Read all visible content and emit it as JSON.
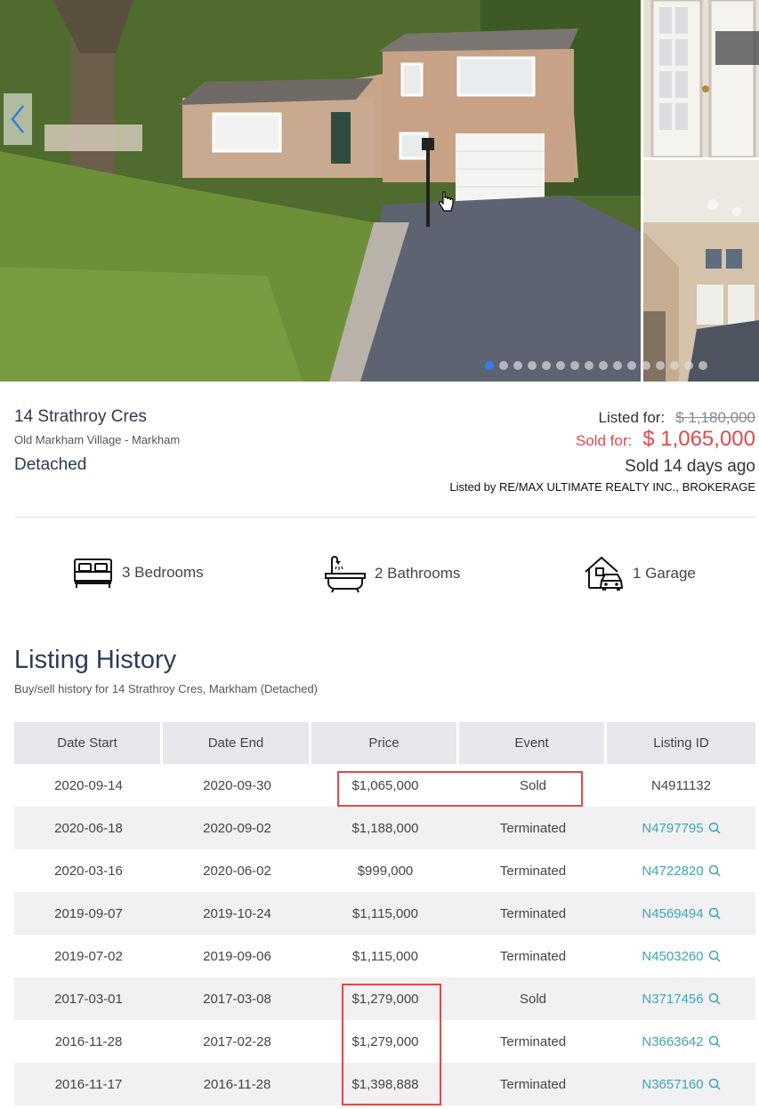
{
  "gallery": {
    "slide_count": 16,
    "active_slide": 1
  },
  "summary": {
    "address": "14 Strathroy Cres",
    "neighbourhood": "Old Markham Village - Markham",
    "property_type": "Detached",
    "listed_label": "Listed for:",
    "listed_price": "$ 1,180,000",
    "sold_label": "Sold for:",
    "sold_price": "$ 1,065,000",
    "sold_ago": "Sold 14 days ago",
    "listed_by": "Listed by RE/MAX ULTIMATE REALTY INC., BROKERAGE"
  },
  "features": {
    "bedrooms": "3 Bedrooms",
    "bathrooms": "2 Bathrooms",
    "garage": "1 Garage"
  },
  "history": {
    "title": "Listing History",
    "subtitle": "Buy/sell history for 14 Strathroy Cres, Markham (Detached)",
    "columns": [
      "Date Start",
      "Date End",
      "Price",
      "Event",
      "Listing ID"
    ],
    "rows": [
      {
        "start": "2020-09-14",
        "end": "2020-09-30",
        "price": "$1,065,000",
        "event": "Sold",
        "id": "N4911132"
      },
      {
        "start": "2020-06-18",
        "end": "2020-09-02",
        "price": "$1,188,000",
        "event": "Terminated",
        "id": "N4797795"
      },
      {
        "start": "2020-03-16",
        "end": "2020-06-02",
        "price": "$999,000",
        "event": "Terminated",
        "id": "N4722820"
      },
      {
        "start": "2019-09-07",
        "end": "2019-10-24",
        "price": "$1,115,000",
        "event": "Terminated",
        "id": "N4569494"
      },
      {
        "start": "2019-07-02",
        "end": "2019-09-06",
        "price": "$1,115,000",
        "event": "Terminated",
        "id": "N4503260"
      },
      {
        "start": "2017-03-01",
        "end": "2017-03-08",
        "price": "$1,279,000",
        "event": "Sold",
        "id": "N3717456"
      },
      {
        "start": "2016-11-28",
        "end": "2017-02-28",
        "price": "$1,279,000",
        "event": "Terminated",
        "id": "N3663642"
      },
      {
        "start": "2016-11-17",
        "end": "2016-11-28",
        "price": "$1,398,888",
        "event": "Terminated",
        "id": "N3657160"
      }
    ]
  },
  "colors": {
    "sold_red": "#e04a4a",
    "link_teal": "#3ea6b0",
    "heading_navy": "#2f3a5a",
    "active_dot": "#2f7fe8"
  },
  "icons": [
    "chevron-left-icon",
    "bed-icon",
    "bathtub-icon",
    "garage-icon",
    "search-icon",
    "hand-cursor-icon"
  ]
}
